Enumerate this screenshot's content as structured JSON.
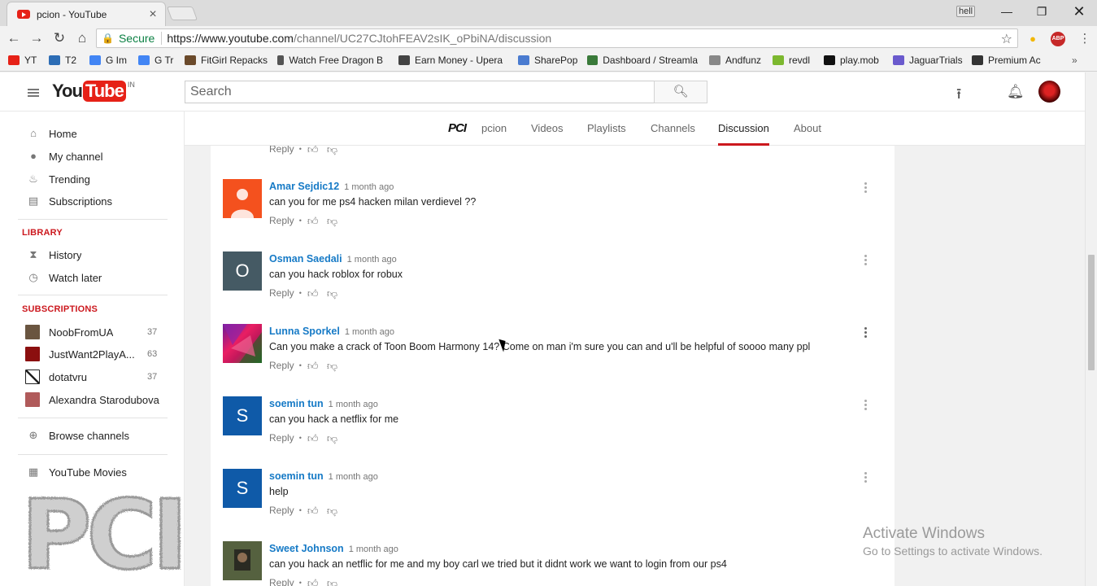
{
  "browser": {
    "tab_title": "pcion - YouTube",
    "user_badge": "hell",
    "secure_label": "Secure",
    "url_host": "https://www.youtube.com",
    "url_path": "/channel/UC27CJtohFEAV2sIK_oPbiNA/discussion",
    "ext_badge": "ABP"
  },
  "bookmarks": [
    {
      "label": "YT",
      "color": "#e62117"
    },
    {
      "label": "T2",
      "color": "#2d6db5"
    },
    {
      "label": "G Im",
      "color": "#4285f4"
    },
    {
      "label": "G Tr",
      "color": "#4285f4"
    },
    {
      "label": "FitGirl Repacks",
      "color": "#6b4a2b"
    },
    {
      "label": "Watch Free Dragon B",
      "color": "#555555"
    },
    {
      "label": "Earn Money - Upera",
      "color": "#444444"
    },
    {
      "label": "SharePop",
      "color": "#4a7bd0"
    },
    {
      "label": "Dashboard / Streamla",
      "color": "#3a7a3a"
    },
    {
      "label": "Andfunz",
      "color": "#888888"
    },
    {
      "label": "revdl",
      "color": "#7cb82f"
    },
    {
      "label": "play.mob",
      "color": "#111111"
    },
    {
      "label": "JaguarTrials",
      "color": "#6a5acd"
    },
    {
      "label": "Premium Ac",
      "color": "#333333"
    }
  ],
  "masthead": {
    "logo_you": "You",
    "logo_tube": "Tube",
    "logo_country": "IN",
    "search_placeholder": "Search"
  },
  "guide": {
    "main": [
      {
        "label": "Home",
        "icon": "home-icon"
      },
      {
        "label": "My channel",
        "icon": "account-icon"
      },
      {
        "label": "Trending",
        "icon": "flame-icon"
      },
      {
        "label": "Subscriptions",
        "icon": "subscriptions-icon"
      }
    ],
    "library_title": "LIBRARY",
    "library": [
      {
        "label": "History",
        "icon": "hourglass-icon"
      },
      {
        "label": "Watch later",
        "icon": "clock-icon"
      }
    ],
    "subscriptions_title": "SUBSCRIPTIONS",
    "subscriptions": [
      {
        "label": "NoobFromUA",
        "count": "37",
        "color": "#6a5540"
      },
      {
        "label": "JustWant2PlayA...",
        "count": "63",
        "color": "#8b0f0f"
      },
      {
        "label": "dotatvru",
        "count": "37",
        "color": "#222222"
      },
      {
        "label": "Alexandra Starodubova",
        "count": "",
        "color": "#b05a5a"
      }
    ],
    "browse_channels": "Browse channels",
    "youtube_movies": "YouTube Movies"
  },
  "channel_nav": {
    "logo_text": "PCI",
    "tabs": [
      "pcion",
      "Videos",
      "Playlists",
      "Channels",
      "Discussion",
      "About"
    ],
    "active": "Discussion"
  },
  "comments": {
    "reply_label": "Reply",
    "items": [
      {
        "author": "Amar Sejdic12",
        "time": "1 month ago",
        "text": "can you for me ps4 hacken  milan verdievel ??",
        "avatar_color": "#f4511e",
        "avatar_letter": ""
      },
      {
        "author": "Osman Saedali",
        "time": "1 month ago",
        "text": "can you hack roblox for robux",
        "avatar_color": "#455a64",
        "avatar_letter": "O"
      },
      {
        "author": "Lunna Sporkel",
        "time": "1 month ago",
        "text": "Can you make a crack of Toon Boom Harmony 14? Come on man i'm sure you can and u'll be helpful of soooo many ppl",
        "avatar_color": "#c2185b",
        "avatar_letter": ""
      },
      {
        "author": "soemin tun",
        "time": "1 month ago",
        "text": "can you hack a netflix for me",
        "avatar_color": "#0f5aa8",
        "avatar_letter": "S"
      },
      {
        "author": "soemin tun",
        "time": "1 month ago",
        "text": "help",
        "avatar_color": "#0f5aa8",
        "avatar_letter": "S"
      },
      {
        "author": "Sweet Johnson",
        "time": "1 month ago",
        "text": "can you hack an netflic for me and my boy carl we tried but it didnt work we want to login from our ps4",
        "avatar_color": "#3b4a2e",
        "avatar_letter": ""
      }
    ]
  },
  "watermark_text": "PCI",
  "windows_notice": {
    "line1": "Activate Windows",
    "line2": "Go to Settings to activate Windows."
  }
}
